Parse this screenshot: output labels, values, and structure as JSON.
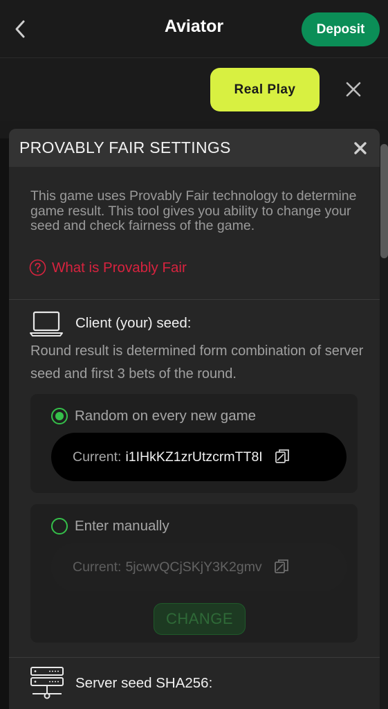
{
  "appbar": {
    "title": "Aviator",
    "deposit_label": "Deposit",
    "back_icon": "chevron-left-icon"
  },
  "bar2": {
    "real_play_label": "Real Play",
    "close_icon": "close-icon"
  },
  "modal": {
    "title": "PROVABLY FAIR SETTINGS",
    "intro": "This game uses Provably Fair technology to determine game result. This tool gives you ability to change your seed and check fairness of the game.",
    "what_is_link": "What is Provably Fair",
    "client": {
      "title": "Client (your) seed:",
      "description": "Round result is determined form combination of server seed and first 3 bets of the round.",
      "random_option": {
        "label": "Random on every new game",
        "selected": true,
        "current_label": "Current:",
        "current_value": "i1IHkKZ1zrUtzcrmTT8I"
      },
      "manual_option": {
        "label": "Enter manually",
        "selected": false,
        "current_label": "Current:",
        "current_value": "5jcwvQCjSKjY3K2gmv",
        "change_label": "CHANGE"
      }
    },
    "server": {
      "title": "Server seed SHA256:"
    }
  },
  "colors": {
    "deposit": "#0b8e57",
    "real_play": "#d8f041",
    "link_red": "#d8233f",
    "radio_green": "#35c04a",
    "modal_bg": "#262626",
    "modal_header": "#333333"
  }
}
